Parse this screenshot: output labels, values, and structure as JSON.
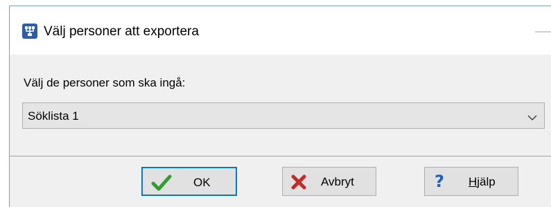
{
  "dialog": {
    "title": "Välj personer att exportera",
    "prompt": "Välj de personer som ska ingå:",
    "selection": {
      "value": "Söklista 1"
    }
  },
  "buttons": {
    "ok": {
      "label": "OK",
      "icon": "checkmark-icon"
    },
    "cancel": {
      "label": "Avbryt",
      "icon": "x-icon"
    },
    "help": {
      "label": "Hjälp",
      "icon": "question-icon"
    }
  },
  "colors": {
    "accent": "#0078d7",
    "app_icon": "#2f5ea8",
    "ok_check": "#2e9e2e",
    "cancel_x": "#c62828",
    "help_q": "#1f5fbf"
  }
}
